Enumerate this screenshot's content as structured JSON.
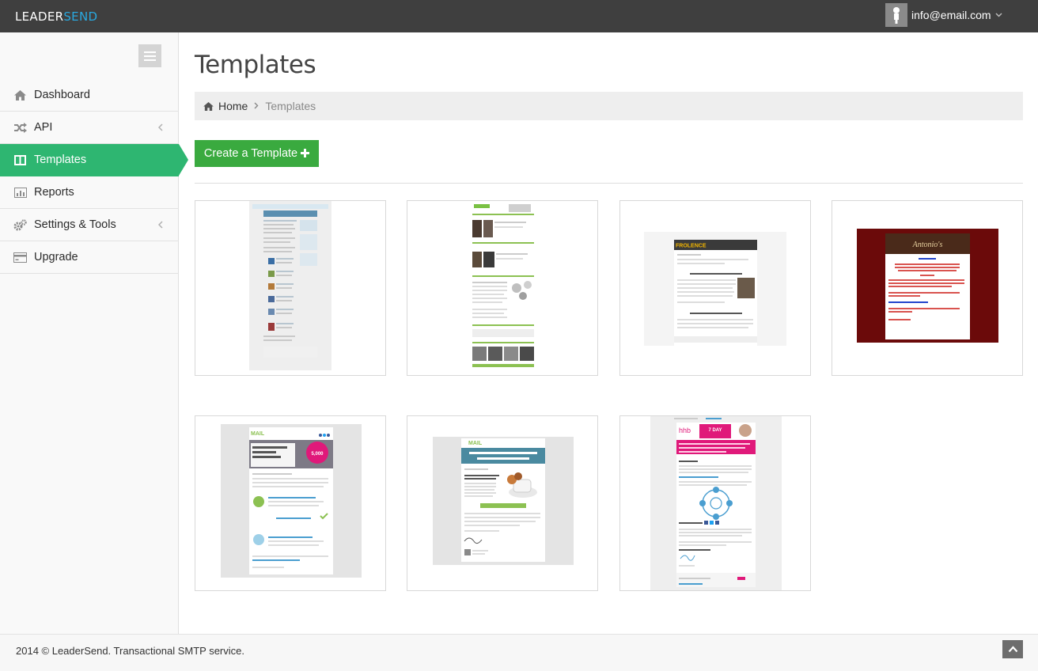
{
  "header": {
    "brand_part1": "LEADER",
    "brand_part2": "SEND",
    "user_email": "info@email.com",
    "avatar_icon": "user-silhouette-icon",
    "caret_icon": "chevron-down-icon"
  },
  "sidebar": {
    "toggle_icon": "hamburger-menu-icon",
    "items": [
      {
        "label": "Dashboard",
        "icon": "home-icon",
        "active": false,
        "has_submenu": false
      },
      {
        "label": "API",
        "icon": "shuffle-icon",
        "active": false,
        "has_submenu": true
      },
      {
        "label": "Templates",
        "icon": "columns-icon",
        "active": true,
        "has_submenu": false
      },
      {
        "label": "Reports",
        "icon": "bar-chart-icon",
        "active": false,
        "has_submenu": false
      },
      {
        "label": "Settings & Tools",
        "icon": "gears-icon",
        "active": false,
        "has_submenu": true
      },
      {
        "label": "Upgrade",
        "icon": "credit-card-icon",
        "active": false,
        "has_submenu": false
      }
    ]
  },
  "main": {
    "title": "Templates",
    "breadcrumb": {
      "home": "Home",
      "current": "Templates"
    },
    "create_button": "Create a Template",
    "create_icon": "plus-icon",
    "templates": [
      {
        "thumbnail": "newsletter-blue-template"
      },
      {
        "thumbnail": "green-newsletter-template"
      },
      {
        "thumbnail": "florence-template",
        "thumb_text": "FROLENCE"
      },
      {
        "thumbnail": "antonios-red-template",
        "thumb_text": "Antonio's"
      },
      {
        "thumbnail": "mail-thanks-template",
        "thumb_text": "MAIL",
        "thumb_badge": "5,000"
      },
      {
        "thumbnail": "mail-coffee-template",
        "thumb_text": "MAIL"
      },
      {
        "thumbnail": "hhb-7day-challenge-template",
        "thumb_text": "hhb",
        "thumb_badge": "7 DAY"
      }
    ]
  },
  "footer": {
    "copyright": "2014 © LeaderSend. Transactional SMTP service.",
    "scroll_top_icon": "chevron-up-icon"
  }
}
